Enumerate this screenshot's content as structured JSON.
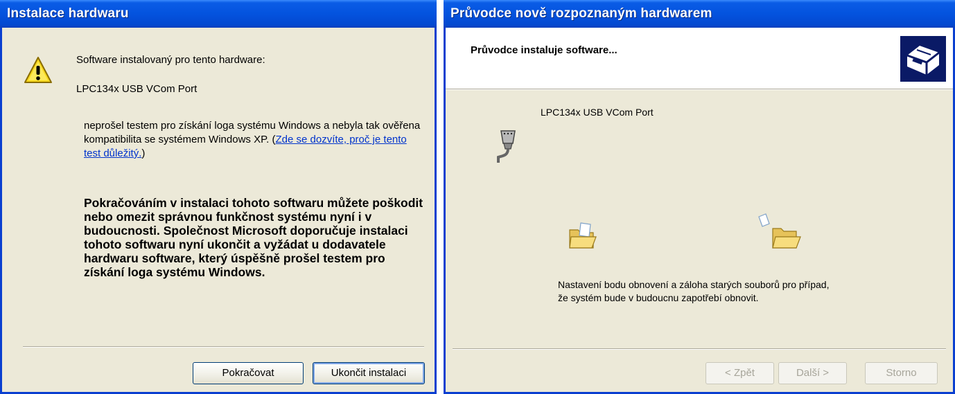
{
  "dialog1": {
    "title": "Instalace hardwaru",
    "installed_for": "Software instalovaný pro tento hardware:",
    "device_name": "LPC134x USB VCom Port",
    "not_passed_text": "neprošel testem pro získání loga systému Windows a nebyla tak ověřena kompatibilita se systémem Windows XP. (",
    "link_text": "Zde se dozvíte, proč je tento test důležitý.",
    "link_close": ")",
    "warning_text": "Pokračováním v instalaci tohoto softwaru můžete poškodit nebo omezit správnou funkčnost systému nyní i v budoucnosti. Společnost Microsoft doporučuje instalaci tohoto softwaru nyní ukončit a vyžádat u dodavatele hardwaru software, který úspěšně prošel testem pro získání loga systému Windows.",
    "continue_button": "Pokračovat",
    "stop_button": "Ukončit instalaci"
  },
  "dialog2": {
    "title": "Průvodce nově rozpoznaným hardwarem",
    "header_text": "Průvodce instaluje software...",
    "device_name": "LPC134x USB VCom Port",
    "status_text": "Nastavení bodu obnovení a záloha starých souborů pro případ, že systém bude v budoucnu zapotřebí obnovit.",
    "back_button": "< Zpět",
    "next_button": "Další >",
    "cancel_button": "Storno"
  },
  "colors": {
    "titlebar": "#0453de",
    "dialog_bg": "#ece9d8",
    "link": "#0033cc"
  }
}
